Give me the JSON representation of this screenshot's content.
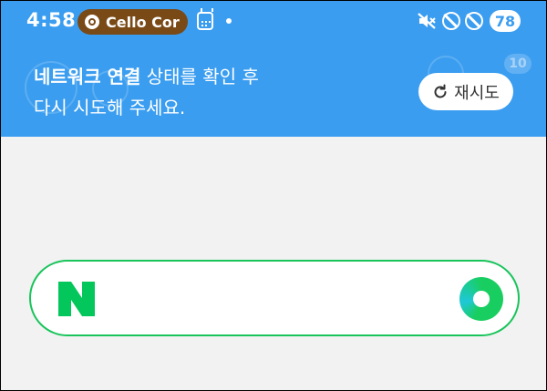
{
  "status_bar": {
    "time": "4:58",
    "recording_chip_label": "Cello Cor",
    "battery_level": "78",
    "icons": [
      "record-icon",
      "calendar-icon",
      "notification-dot",
      "mute-icon",
      "block-icon",
      "block-icon"
    ]
  },
  "banner": {
    "message_bold": "네트워크 연결",
    "message_rest_line1": " 상태를 확인 후",
    "message_line2": "다시 시도해 주세요.",
    "retry_label": "재시도",
    "background_badge": "10",
    "colors": {
      "background": "#3a9df0",
      "text": "#ffffff"
    }
  },
  "search": {
    "logo_letter": "N",
    "colors": {
      "border": "#19c45b",
      "brand_green": "#03c75a"
    }
  }
}
